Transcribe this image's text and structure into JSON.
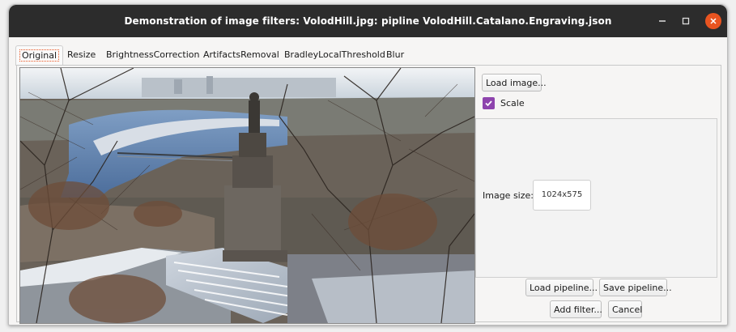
{
  "window": {
    "title": "Demonstration of image filters: VolodHill.jpg: pipline VolodHill.Catalano.Engraving.json"
  },
  "window_controls": {
    "minimize": "minimize-icon",
    "maximize": "maximize-icon",
    "close": "close-icon",
    "close_color": "#e95420"
  },
  "tabs": [
    {
      "label": "Original",
      "active": true
    },
    {
      "label": "Resize"
    },
    {
      "label": "BrightnessCorrection"
    },
    {
      "label": "ArtifactsRemoval"
    },
    {
      "label": "BradleyLocalThreshold"
    },
    {
      "label": "Blur"
    }
  ],
  "side": {
    "load_image": "Load image...",
    "scale_label": "Scale",
    "scale_checked": true,
    "image_size_label": "Image size:",
    "image_size_value": "1024x575"
  },
  "footer": {
    "load_pipeline": "Load pipeline...",
    "save_pipeline": "Save pipeline...",
    "add_filter": "Add filter...",
    "cancel": "Cancel"
  },
  "colors": {
    "accent": "#e95420",
    "checkbox": "#8e44ad",
    "titlebar": "#2c2c2c"
  }
}
